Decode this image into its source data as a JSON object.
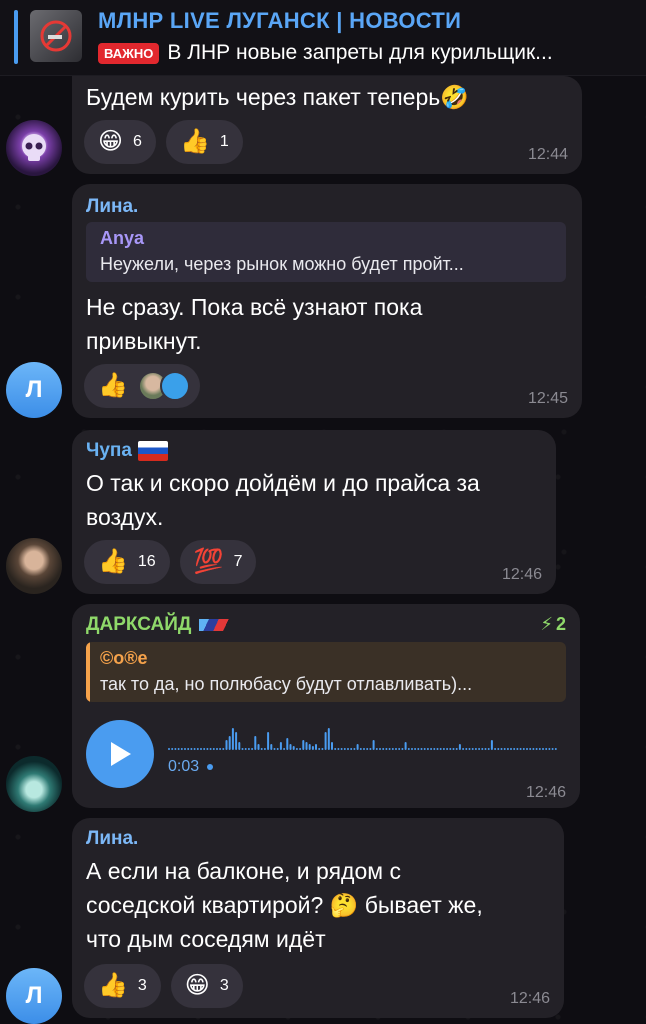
{
  "pinned": {
    "title": "МЛНР LIVE ЛУГАНСК | НОВОСТИ",
    "badge": "ВАЖНО",
    "text": "В ЛНР новые запреты для курильщик..."
  },
  "messages": [
    {
      "text": "Будем курить через пакет теперь🤣",
      "reactions": [
        {
          "emoji": "😁",
          "count": "6"
        },
        {
          "emoji": "👍",
          "count": "1"
        }
      ],
      "time": "12:44"
    },
    {
      "sender": "Лина.",
      "reply": {
        "name": "Anya",
        "text": "Неужели, через рынок можно будет пройт..."
      },
      "text_lines": [
        "Не сразу. Пока всё узнают  пока",
        "привыкнут."
      ],
      "reactions": [
        {
          "emoji": "👍"
        }
      ],
      "time": "12:45",
      "avatar_letter": "Л"
    },
    {
      "sender": "Чупа",
      "text_lines": [
        "О так и скоро дойдём и до прайса за",
        "воздух."
      ],
      "reactions": [
        {
          "emoji": "👍",
          "count": "16"
        },
        {
          "emoji": "💯",
          "count": "7"
        }
      ],
      "time": "12:46"
    },
    {
      "sender": "ДАРКСАЙД",
      "boost": "2",
      "reply": {
        "name": "©o®e",
        "text": "так то да, но полюбасу будут отлавливать)..."
      },
      "voice": {
        "duration": "0:03"
      },
      "time": "12:46"
    },
    {
      "sender": "Лина.",
      "text_lines": [
        "А если на балконе, и рядом с",
        "соседской квартирой? 🤔 бывает же,",
        "что дым соседям идёт"
      ],
      "reactions": [
        {
          "emoji": "👍",
          "count": "3"
        },
        {
          "emoji": "😁",
          "count": "3"
        }
      ],
      "time": "12:46",
      "avatar_letter": "Л"
    }
  ],
  "colors": {
    "accent_blue": "#4a9cf0",
    "lina_name": "#7cb8f7",
    "chupa_name": "#6ab2f2",
    "darkside_name": "#8fd96a",
    "reply_orange": "#f5a24b"
  }
}
